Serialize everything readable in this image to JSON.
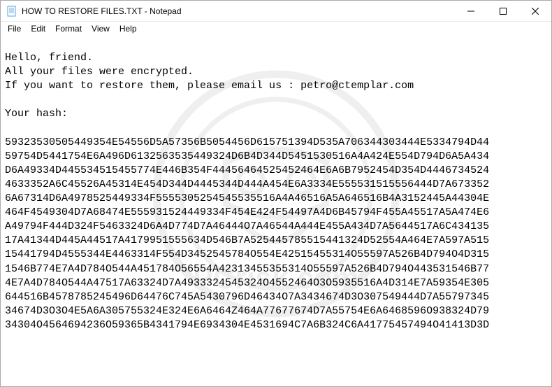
{
  "titlebar": {
    "title": "HOW TO RESTORE FILES.TXT - Notepad"
  },
  "menubar": {
    "file": "File",
    "edit": "Edit",
    "format": "Format",
    "view": "View",
    "help": "Help"
  },
  "content": {
    "line1": "Hello, friend.",
    "line2": "All your files were encrypted.",
    "line3": "If you want to restore them, please email us : petro@ctemplar.com",
    "blank": "",
    "hash_label": "Your hash:",
    "hash": "59323530505449354E54556D5A57356B5054456D615751394D535A706344303444E5334794D4459754D5441754E6A496D6132563535449324D6B4D344D5451530516A4A424E554D794D6A5A434D6A49334D445534515455774E446B354F44456464525452464E6A6B7952454D354D44467345244633352A6C45526A45314E454D344D4445344D444A454E6A3334E555531515556444D7A6733526A67314D6A4978525449334F5555305254545535516A4A46516A5A646516B4A3152445A44304E464F4549304D7A68474E555931524449334F454E424F54497A4D6B45794F455A45517A5A474E6A49794F444D324F5463324D6A4D774D7A46444O7A46544A444E455A434D7A5644517A6C43413517A41344D445A44517A4179951555634D546B7A525445785515441324D52554A464E7A597A51515441794D4555344E4463314F554D3452545784O554E42515455314O55597A526B4D794O4D3151546B774E7A4D784O544A451784O56554A42313455355314O55597A526B4D794O443531546B774E7A4D784O544A47517A63324D7A4933324545324O4552464O3O5935516A4D314E7A59354E305644516B4578785245496D64476C745A5430796D46434O7A3434674D3O307549444D7A5579734534674D3O3О4E5A6A305755324E324E6A6464Z464A77677674D7A55754E6A6468596O938324D7934304O4564694236O59365B4341794E6934304E4531694C7A6B324C6A41775457494O41413D3D"
  }
}
